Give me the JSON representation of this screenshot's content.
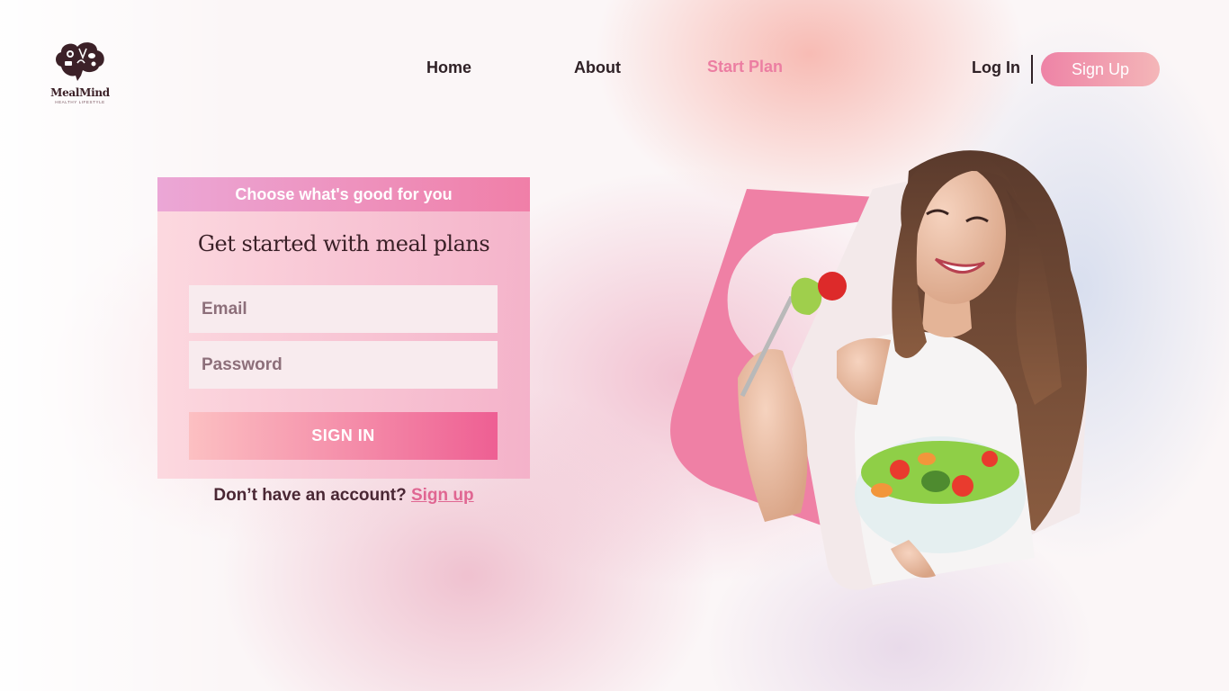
{
  "brand": {
    "name": "MealMind",
    "tagline": "HEALTHY LIFESTYLE"
  },
  "nav": {
    "items": [
      {
        "label": "Home"
      },
      {
        "label": "About"
      },
      {
        "label": "Start Plan",
        "active": true
      }
    ],
    "login_label": "Log In",
    "signup_label": "Sign Up"
  },
  "card": {
    "header": "Choose what's good for you",
    "title": "Get started with meal plans",
    "email_placeholder": "Email",
    "password_placeholder": "Password",
    "signin_label": "SIGN IN"
  },
  "account": {
    "prompt": "Don’t have an account?",
    "link_label": "Sign up"
  },
  "colors": {
    "accent_pink": "#ec7ea2",
    "dark_text": "#2f2126",
    "signin_gradient_start": "#fcc0c2",
    "signin_gradient_end": "#ee5f93"
  },
  "icons": {
    "logo": "brain-food-icon",
    "hero": "woman-eating-salad-image"
  }
}
